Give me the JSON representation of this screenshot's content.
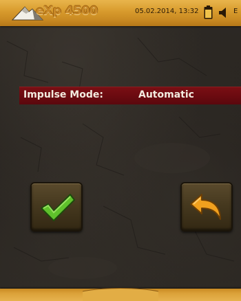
{
  "status_bar": {
    "logo_text": "eXp 4500",
    "datetime": "05.02.2014, 13:32",
    "language": "E",
    "battery_icon": "battery-icon",
    "speaker_icon": "speaker-icon"
  },
  "setting": {
    "label": "Impulse Mode:",
    "value": "Automatic"
  },
  "buttons": {
    "confirm_icon": "checkmark-icon",
    "back_icon": "back-arrow-icon"
  },
  "colors": {
    "bar_gold": "#d79a2c",
    "setting_row_red": "#6a0a10",
    "checkmark_green": "#5fc12c",
    "back_arrow_orange": "#f0a01e",
    "background_dark": "#2a2621"
  }
}
